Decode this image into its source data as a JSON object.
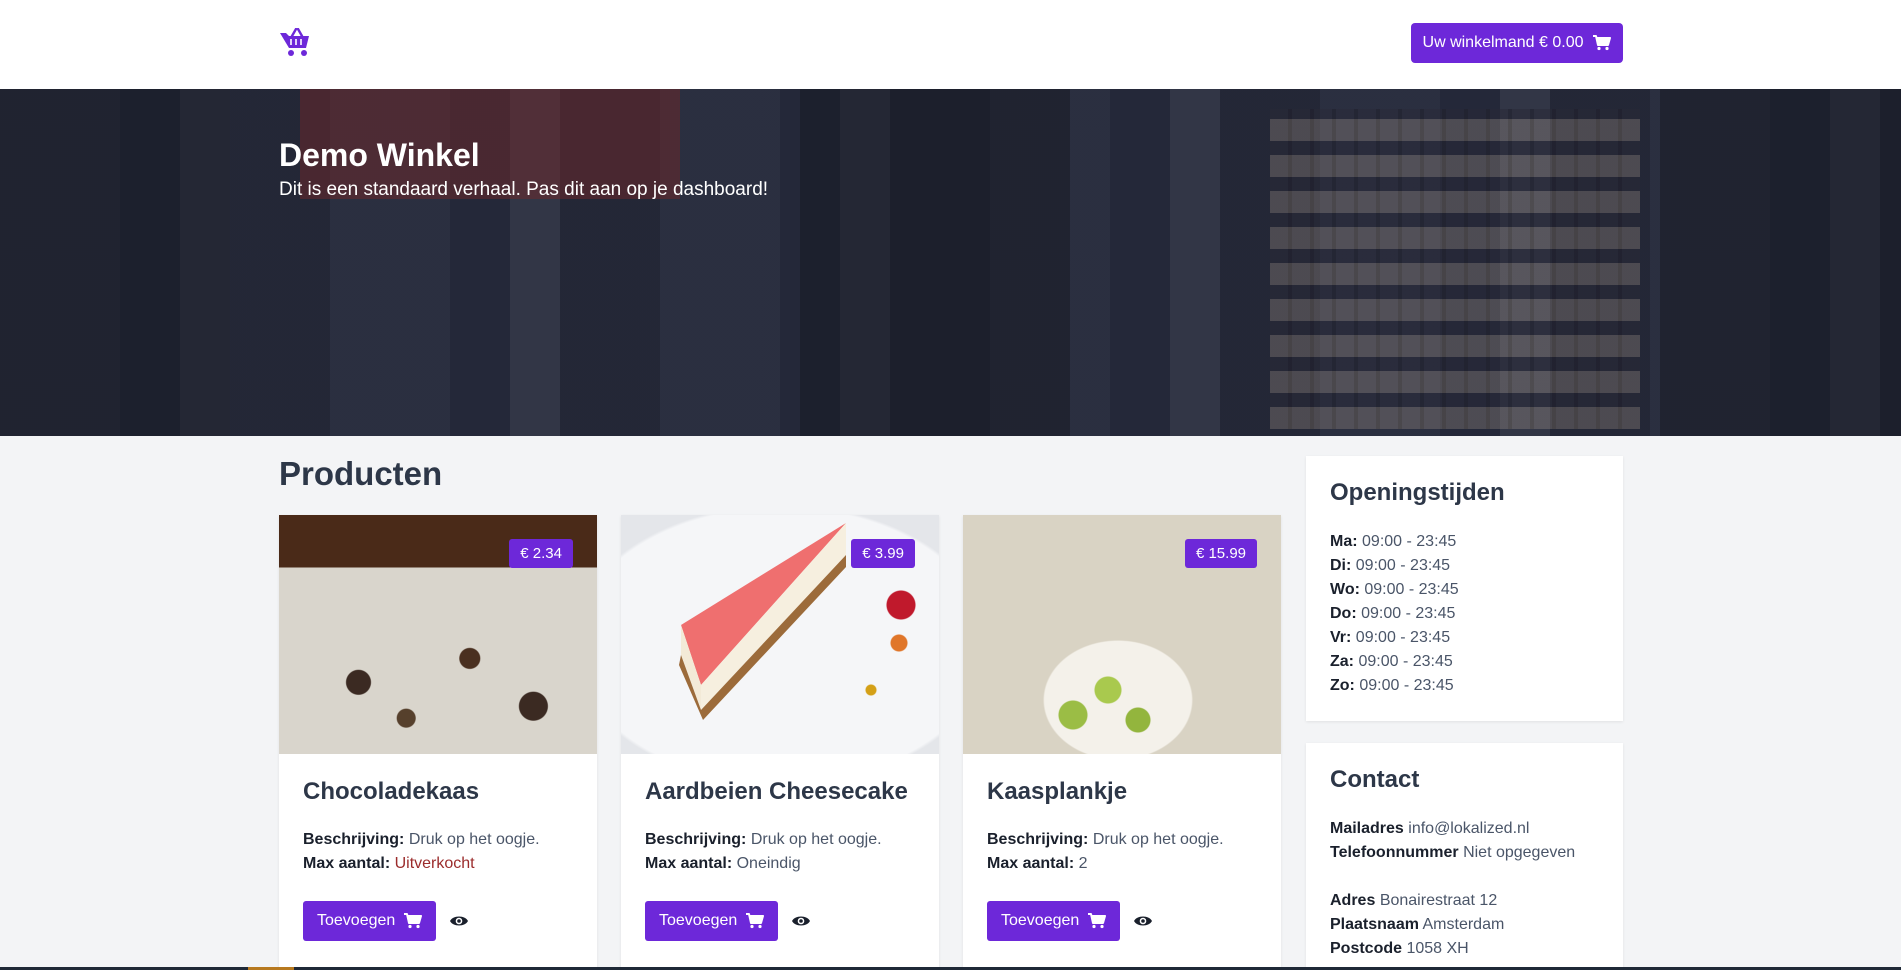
{
  "header": {
    "cart_label": "Uw winkelmand € 0.00",
    "logo_icon": "shopping-basket-icon",
    "cart_icon": "cart-icon"
  },
  "hero": {
    "title": "Demo Winkel",
    "subtitle": "Dit is een standaard verhaal. Pas dit aan op je dashboard!"
  },
  "products": {
    "title": "Producten",
    "desc_label": "Beschrijving:",
    "max_label": "Max aantal:",
    "add_label": "Toevoegen",
    "items": [
      {
        "name": "Chocoladekaas",
        "price": "€ 2.34",
        "description": "Druk op het oogje.",
        "max": "Uitverkocht",
        "image": "chocolate-cheese-photo"
      },
      {
        "name": "Aardbeien Cheesecake",
        "price": "€ 3.99",
        "description": "Druk op het oogje.",
        "max": "Oneindig",
        "image": "cheesecake-photo"
      },
      {
        "name": "Kaasplankje",
        "price": "€ 15.99",
        "description": "Druk op het oogje.",
        "max": "2",
        "image": "cheese-board-photo"
      }
    ]
  },
  "opening_hours": {
    "title": "Openingstijden",
    "rows": [
      {
        "day": "Ma:",
        "hours": "09:00 - 23:45"
      },
      {
        "day": "Di:",
        "hours": "09:00 - 23:45"
      },
      {
        "day": "Wo:",
        "hours": "09:00 - 23:45"
      },
      {
        "day": "Do:",
        "hours": "09:00 - 23:45"
      },
      {
        "day": "Vr:",
        "hours": "09:00 - 23:45"
      },
      {
        "day": "Za:",
        "hours": "09:00 - 23:45"
      },
      {
        "day": "Zo:",
        "hours": "09:00 - 23:45"
      }
    ]
  },
  "contact": {
    "title": "Contact",
    "email_label": "Mailadres",
    "email": "info@lokalized.nl",
    "phone_label": "Telefoonnummer",
    "phone": "Niet opgegeven",
    "address_label": "Adres",
    "address": "Bonairestraat 12",
    "city_label": "Plaatsnaam",
    "city": "Amsterdam",
    "zip_label": "Postcode",
    "zip": "1058 XH"
  },
  "colors": {
    "accent": "#6d28d9",
    "sold_out": "#9b2c2c",
    "background": "#f3f4f6"
  }
}
